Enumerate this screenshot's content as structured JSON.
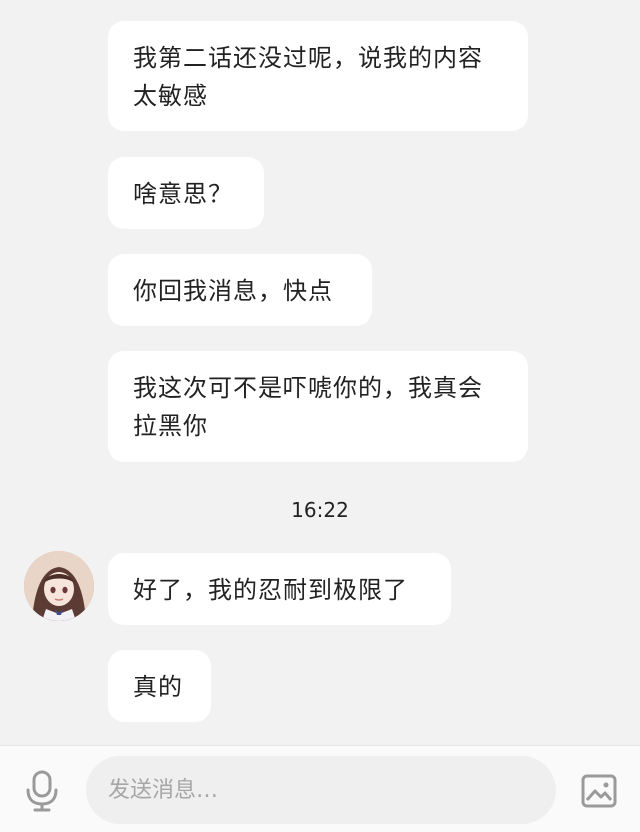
{
  "messages": [
    {
      "text": "我第二话还没过呢，说我的内容太敏感"
    },
    {
      "text": "啥意思？"
    },
    {
      "text": "你回我消息，快点"
    },
    {
      "text": "我这次可不是吓唬你的，我真会拉黑你"
    },
    {
      "text": "好了，我的忍耐到极限了"
    },
    {
      "text": "真的"
    }
  ],
  "timestamp": "16:22",
  "input": {
    "placeholder": "发送消息…"
  },
  "icons": {
    "mic": "microphone-icon",
    "image": "image-icon"
  },
  "colors": {
    "background": "#f2f2f2",
    "bubble": "#ffffff",
    "text": "#222222",
    "placeholder": "#a6a6a6"
  }
}
